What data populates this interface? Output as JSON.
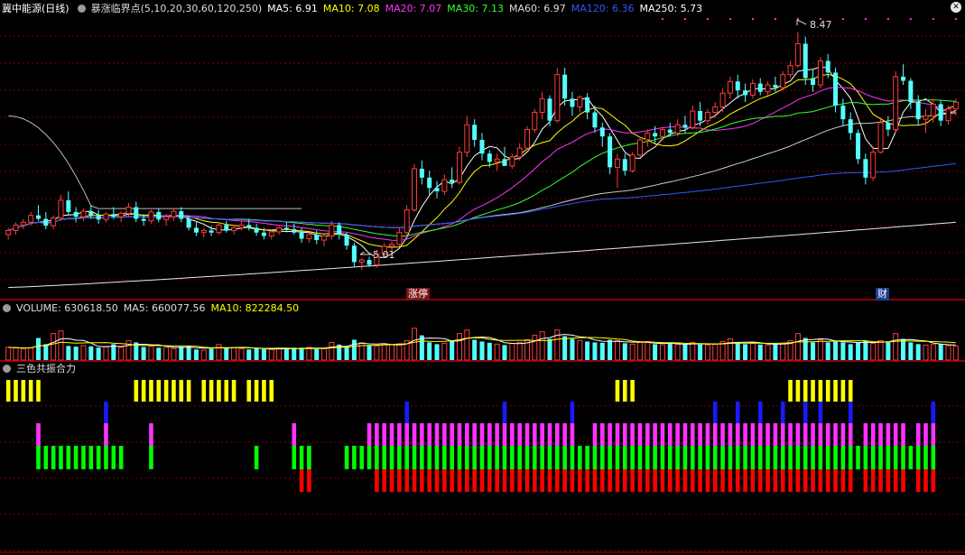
{
  "main_header": {
    "stock": "冀中能源(日线)",
    "indicator": "暴涨临界点(5,10,20,30,60,120,250)",
    "ma": [
      {
        "label": "MA5: 6.91",
        "color": "#ffffff"
      },
      {
        "label": "MA10: 7.08",
        "color": "#ffff00"
      },
      {
        "label": "MA20: 7.07",
        "color": "#ff33ff"
      },
      {
        "label": "MA30: 7.13",
        "color": "#33ff33"
      },
      {
        "label": "MA60: 6.97",
        "color": "#dddddd"
      },
      {
        "label": "MA120: 6.36",
        "color": "#3355ff"
      },
      {
        "label": "MA250: 5.73",
        "color": "#ffffff"
      }
    ]
  },
  "volume_header": {
    "items": [
      {
        "label": "VOLUME: 630618.50",
        "color": "#dddddd"
      },
      {
        "label": "MA5: 660077.56",
        "color": "#dddddd"
      },
      {
        "label": "MA10: 822284.50",
        "color": "#ffff00"
      }
    ]
  },
  "sub_header": {
    "title": "三色共振合力"
  },
  "markers": {
    "high_label": "8.47",
    "low_label": "5.01",
    "zhangting": "涨停",
    "cai": "财"
  },
  "colors": {
    "up": "#ff3c3c",
    "down": "#54ffff",
    "grid": "#7a0000",
    "panel_border": "#a00000"
  },
  "chart_data": {
    "type": "candlestick",
    "price_range": [
      4.6,
      8.7
    ],
    "candles": [
      [
        5.52,
        5.62,
        5.45,
        5.58
      ],
      [
        5.58,
        5.7,
        5.52,
        5.66
      ],
      [
        5.66,
        5.75,
        5.6,
        5.7
      ],
      [
        5.7,
        5.85,
        5.65,
        5.8
      ],
      [
        5.8,
        5.95,
        5.72,
        5.75
      ],
      [
        5.75,
        5.85,
        5.6,
        5.65
      ],
      [
        5.65,
        5.8,
        5.6,
        5.76
      ],
      [
        5.76,
        6.1,
        5.72,
        6.02
      ],
      [
        6.02,
        6.15,
        5.8,
        5.85
      ],
      [
        5.85,
        5.92,
        5.7,
        5.78
      ],
      [
        5.78,
        5.9,
        5.72,
        5.86
      ],
      [
        5.86,
        5.95,
        5.75,
        5.8
      ],
      [
        5.8,
        5.88,
        5.68,
        5.74
      ],
      [
        5.74,
        5.85,
        5.7,
        5.82
      ],
      [
        5.82,
        5.92,
        5.75,
        5.78
      ],
      [
        5.78,
        5.86,
        5.7,
        5.83
      ],
      [
        5.83,
        5.98,
        5.78,
        5.92
      ],
      [
        5.92,
        6.0,
        5.7,
        5.75
      ],
      [
        5.75,
        5.82,
        5.65,
        5.72
      ],
      [
        5.72,
        5.88,
        5.68,
        5.85
      ],
      [
        5.85,
        5.9,
        5.7,
        5.74
      ],
      [
        5.74,
        5.82,
        5.65,
        5.78
      ],
      [
        5.78,
        5.9,
        5.72,
        5.86
      ],
      [
        5.86,
        5.92,
        5.7,
        5.75
      ],
      [
        5.75,
        5.8,
        5.58,
        5.62
      ],
      [
        5.62,
        5.7,
        5.5,
        5.55
      ],
      [
        5.55,
        5.62,
        5.48,
        5.58
      ],
      [
        5.58,
        5.65,
        5.5,
        5.55
      ],
      [
        5.55,
        5.7,
        5.52,
        5.66
      ],
      [
        5.66,
        5.72,
        5.55,
        5.58
      ],
      [
        5.58,
        5.66,
        5.52,
        5.62
      ],
      [
        5.62,
        5.72,
        5.58,
        5.66
      ],
      [
        5.66,
        5.75,
        5.58,
        5.62
      ],
      [
        5.62,
        5.68,
        5.5,
        5.55
      ],
      [
        5.55,
        5.62,
        5.45,
        5.5
      ],
      [
        5.5,
        5.6,
        5.45,
        5.56
      ],
      [
        5.56,
        5.66,
        5.52,
        5.62
      ],
      [
        5.62,
        5.7,
        5.55,
        5.6
      ],
      [
        5.6,
        5.68,
        5.52,
        5.55
      ],
      [
        5.55,
        5.62,
        5.4,
        5.46
      ],
      [
        5.46,
        5.55,
        5.4,
        5.52
      ],
      [
        5.52,
        5.58,
        5.38,
        5.44
      ],
      [
        5.44,
        5.52,
        5.35,
        5.5
      ],
      [
        5.5,
        5.72,
        5.45,
        5.66
      ],
      [
        5.66,
        5.7,
        5.45,
        5.52
      ],
      [
        5.52,
        5.55,
        5.3,
        5.36
      ],
      [
        5.36,
        5.4,
        5.05,
        5.12
      ],
      [
        5.12,
        5.18,
        5.01,
        5.15
      ],
      [
        5.15,
        5.2,
        5.05,
        5.08
      ],
      [
        5.08,
        5.3,
        5.04,
        5.24
      ],
      [
        5.24,
        5.4,
        5.18,
        5.35
      ],
      [
        5.35,
        5.42,
        5.25,
        5.38
      ],
      [
        5.38,
        5.62,
        5.35,
        5.55
      ],
      [
        5.55,
        5.95,
        5.5,
        5.88
      ],
      [
        5.88,
        6.55,
        5.85,
        6.48
      ],
      [
        6.48,
        6.6,
        6.25,
        6.35
      ],
      [
        6.35,
        6.45,
        6.1,
        6.2
      ],
      [
        6.2,
        6.3,
        6.05,
        6.15
      ],
      [
        6.15,
        6.4,
        6.1,
        6.32
      ],
      [
        6.32,
        6.5,
        6.2,
        6.28
      ],
      [
        6.28,
        6.8,
        6.25,
        6.72
      ],
      [
        6.72,
        7.25,
        6.65,
        7.12
      ],
      [
        7.12,
        7.2,
        6.8,
        6.9
      ],
      [
        6.9,
        7.0,
        6.6,
        6.7
      ],
      [
        6.7,
        6.75,
        6.5,
        6.58
      ],
      [
        6.58,
        6.7,
        6.45,
        6.62
      ],
      [
        6.62,
        6.8,
        6.55,
        6.52
      ],
      [
        6.52,
        6.7,
        6.48,
        6.65
      ],
      [
        6.65,
        6.85,
        6.6,
        6.78
      ],
      [
        6.78,
        7.1,
        6.75,
        7.05
      ],
      [
        7.05,
        7.35,
        7.0,
        7.3
      ],
      [
        7.3,
        7.6,
        7.2,
        7.5
      ],
      [
        7.5,
        7.55,
        7.1,
        7.18
      ],
      [
        7.18,
        7.95,
        7.15,
        7.85
      ],
      [
        7.85,
        7.95,
        7.4,
        7.5
      ],
      [
        7.5,
        7.6,
        7.25,
        7.38
      ],
      [
        7.38,
        7.55,
        7.3,
        7.52
      ],
      [
        7.52,
        7.58,
        7.2,
        7.3
      ],
      [
        7.3,
        7.4,
        7.0,
        7.08
      ],
      [
        7.08,
        7.15,
        6.8,
        6.95
      ],
      [
        6.95,
        7.0,
        6.4,
        6.5
      ],
      [
        6.5,
        6.7,
        6.2,
        6.62
      ],
      [
        6.62,
        6.7,
        6.38,
        6.45
      ],
      [
        6.45,
        6.72,
        6.42,
        6.68
      ],
      [
        6.68,
        6.95,
        6.65,
        6.9
      ],
      [
        6.9,
        7.05,
        6.8,
        7.0
      ],
      [
        7.0,
        7.1,
        6.85,
        6.95
      ],
      [
        6.95,
        7.08,
        6.88,
        7.05
      ],
      [
        7.05,
        7.15,
        6.95,
        7.0
      ],
      [
        7.0,
        7.2,
        6.95,
        7.12
      ],
      [
        7.12,
        7.25,
        7.0,
        7.08
      ],
      [
        7.08,
        7.4,
        7.05,
        7.32
      ],
      [
        7.32,
        7.45,
        7.1,
        7.18
      ],
      [
        7.18,
        7.35,
        7.12,
        7.3
      ],
      [
        7.3,
        7.45,
        7.22,
        7.38
      ],
      [
        7.38,
        7.65,
        7.3,
        7.58
      ],
      [
        7.58,
        7.82,
        7.5,
        7.75
      ],
      [
        7.75,
        7.85,
        7.5,
        7.62
      ],
      [
        7.62,
        7.72,
        7.45,
        7.55
      ],
      [
        7.55,
        7.78,
        7.5,
        7.72
      ],
      [
        7.72,
        7.8,
        7.55,
        7.6
      ],
      [
        7.6,
        7.75,
        7.55,
        7.7
      ],
      [
        7.7,
        7.82,
        7.6,
        7.66
      ],
      [
        7.66,
        7.9,
        7.62,
        7.85
      ],
      [
        7.85,
        8.05,
        7.8,
        7.98
      ],
      [
        7.98,
        8.47,
        7.95,
        8.3
      ],
      [
        8.3,
        8.4,
        7.7,
        7.8
      ],
      [
        7.8,
        7.92,
        7.6,
        7.7
      ],
      [
        7.7,
        8.1,
        7.65,
        8.05
      ],
      [
        8.05,
        8.15,
        7.8,
        7.88
      ],
      [
        7.88,
        7.95,
        7.3,
        7.4
      ],
      [
        7.4,
        7.5,
        7.1,
        7.2
      ],
      [
        7.2,
        7.3,
        6.9,
        7.0
      ],
      [
        7.0,
        7.05,
        6.55,
        6.62
      ],
      [
        6.62,
        6.7,
        6.25,
        6.35
      ],
      [
        6.35,
        6.8,
        6.3,
        6.72
      ],
      [
        6.72,
        7.2,
        6.7,
        7.15
      ],
      [
        7.15,
        7.25,
        6.95,
        7.05
      ],
      [
        7.05,
        7.9,
        7.0,
        7.82
      ],
      [
        7.82,
        8.0,
        7.7,
        7.76
      ],
      [
        7.76,
        7.8,
        7.35,
        7.45
      ],
      [
        7.45,
        7.55,
        7.12,
        7.2
      ],
      [
        7.2,
        7.35,
        7.0,
        7.25
      ],
      [
        7.25,
        7.5,
        7.15,
        7.42
      ],
      [
        7.42,
        7.48,
        7.1,
        7.18
      ],
      [
        7.18,
        7.4,
        7.12,
        7.35
      ],
      [
        7.35,
        7.5,
        7.25,
        7.45
      ]
    ],
    "volume_range": [
      0,
      2400000
    ],
    "volume_values": [
      720000,
      690000,
      650000,
      700000,
      1250000,
      900000,
      1500000,
      1650000,
      800000,
      760000,
      820000,
      780000,
      700000,
      740000,
      900000,
      720000,
      1100000,
      1000000,
      740000,
      780000,
      700000,
      720000,
      650000,
      760000,
      800000,
      600000,
      560000,
      640000,
      880000,
      720000,
      700000,
      650000,
      600000,
      680000,
      620000,
      600000,
      660000,
      640000,
      700000,
      700000,
      720000,
      620000,
      640000,
      1000000,
      880000,
      760000,
      1150000,
      980000,
      820000,
      800000,
      900000,
      860000,
      920000,
      1100000,
      1800000,
      1400000,
      1000000,
      900000,
      950000,
      1100000,
      1500000,
      1700000,
      1150000,
      1050000,
      980000,
      900000,
      850000,
      940000,
      1000000,
      1150000,
      1400000,
      1600000,
      1200000,
      1700000,
      1350000,
      1200000,
      1100000,
      1050000,
      1000000,
      980000,
      1150000,
      1100000,
      950000,
      900000,
      1000000,
      1050000,
      900000,
      860000,
      940000,
      880000,
      900000,
      1000000,
      880000,
      850000,
      900000,
      1050000,
      1200000,
      1000000,
      900000,
      950000,
      880000,
      860000,
      900000,
      960000,
      1100000,
      1500000,
      1250000,
      1000000,
      1150000,
      1000000,
      1050000,
      1000000,
      900000,
      1000000,
      1100000,
      950000,
      1100000,
      1000000,
      1500000,
      1200000,
      1000000,
      900000,
      850000,
      880000,
      900000,
      820000,
      800000
    ],
    "signals": {
      "yellow": [
        0,
        1,
        2,
        3,
        4,
        17,
        18,
        19,
        20,
        21,
        22,
        23,
        24,
        26,
        27,
        28,
        29,
        30,
        32,
        33,
        34,
        35,
        81,
        82,
        83,
        104,
        105,
        106,
        107,
        108,
        109,
        110,
        111,
        112
      ],
      "blue": [
        13,
        53,
        66,
        75,
        94,
        97,
        100,
        103,
        106,
        108,
        112,
        123
      ],
      "magenta": [
        4,
        13,
        19,
        38,
        48,
        49,
        50,
        51,
        52,
        53,
        54,
        55,
        56,
        57,
        58,
        59,
        60,
        61,
        62,
        63,
        64,
        65,
        66,
        67,
        68,
        69,
        70,
        71,
        72,
        73,
        74,
        75,
        78,
        79,
        80,
        81,
        82,
        83,
        84,
        85,
        86,
        87,
        88,
        89,
        90,
        91,
        92,
        93,
        94,
        95,
        96,
        97,
        98,
        99,
        100,
        101,
        102,
        103,
        104,
        105,
        106,
        107,
        108,
        109,
        110,
        111,
        112,
        114,
        115,
        116,
        117,
        118,
        119,
        121,
        122,
        123
      ],
      "green": [
        4,
        5,
        6,
        7,
        8,
        9,
        10,
        11,
        12,
        13,
        14,
        15,
        19,
        33,
        38,
        39,
        40,
        45,
        46,
        47,
        48,
        49,
        50,
        51,
        52,
        53,
        54,
        55,
        56,
        57,
        58,
        59,
        60,
        61,
        62,
        63,
        64,
        65,
        66,
        67,
        68,
        69,
        70,
        71,
        72,
        73,
        74,
        75,
        76,
        77,
        78,
        79,
        80,
        81,
        82,
        83,
        84,
        85,
        86,
        87,
        88,
        89,
        90,
        91,
        92,
        93,
        94,
        95,
        96,
        97,
        98,
        99,
        100,
        101,
        102,
        103,
        104,
        105,
        106,
        107,
        108,
        109,
        110,
        111,
        112,
        113,
        114,
        115,
        116,
        117,
        118,
        119,
        120,
        121,
        122,
        123
      ],
      "red": [
        39,
        40,
        49,
        50,
        51,
        52,
        53,
        54,
        55,
        56,
        57,
        58,
        59,
        60,
        61,
        62,
        63,
        64,
        65,
        66,
        67,
        68,
        69,
        70,
        71,
        72,
        73,
        74,
        75,
        76,
        77,
        78,
        79,
        80,
        81,
        82,
        83,
        84,
        85,
        86,
        87,
        88,
        89,
        90,
        91,
        92,
        93,
        94,
        95,
        96,
        97,
        98,
        99,
        100,
        101,
        102,
        103,
        104,
        105,
        106,
        107,
        108,
        109,
        110,
        111,
        112,
        114,
        115,
        116,
        117,
        118,
        119,
        121,
        122,
        123
      ]
    }
  }
}
